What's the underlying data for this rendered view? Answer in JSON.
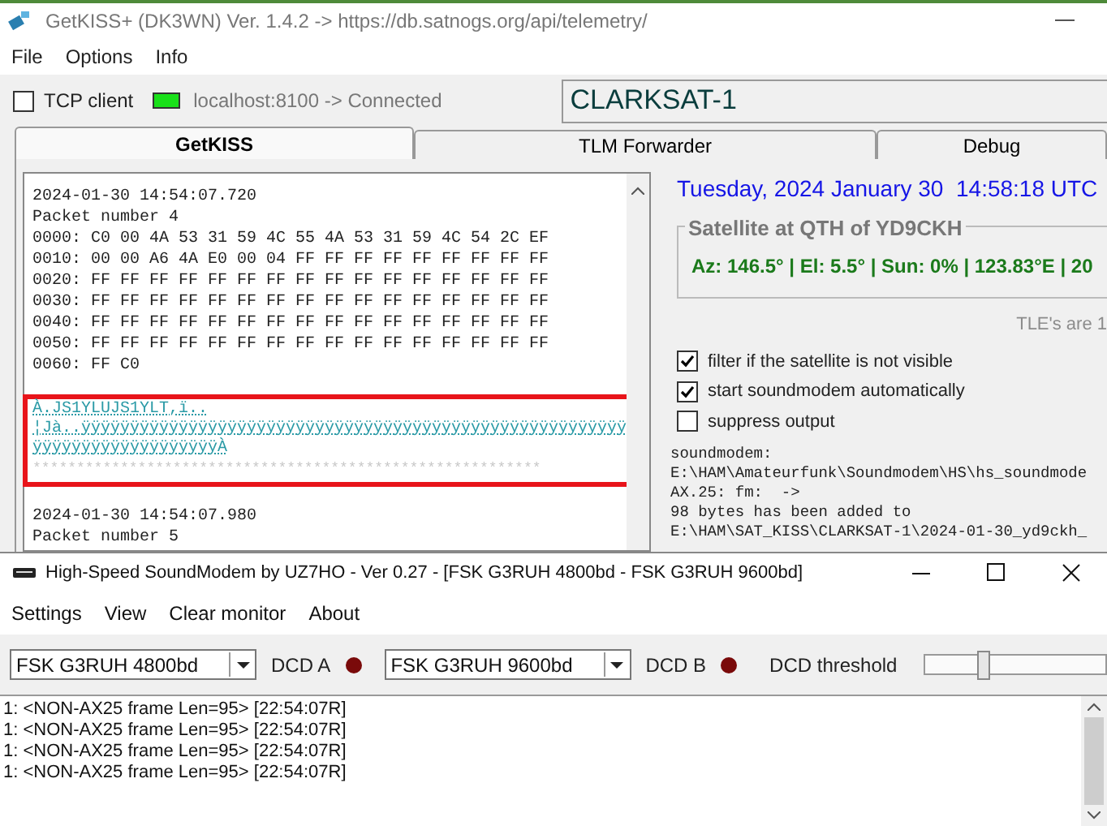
{
  "getkiss_window": {
    "title": "GetKISS+ (DK3WN) Ver. 1.4.2 -> https://db.satnogs.org/api/telemetry/",
    "menu": [
      "File",
      "Options",
      "Info"
    ],
    "tcp_client": {
      "label": "TCP client",
      "checked": false
    },
    "connection": {
      "status": "localhost:8100 -> Connected",
      "connected": true
    },
    "satellite_field": {
      "value": "CLARKSAT-1"
    },
    "tabs": [
      {
        "label": "GetKISS",
        "selected": true
      },
      {
        "label": "TLM Forwarder",
        "selected": false
      },
      {
        "label": "Debug",
        "selected": false
      }
    ],
    "monitor": {
      "lines": [
        "2024-01-30 14:54:07.720",
        "Packet number 4",
        "0000: C0 00 4A 53 31 59 4C 55 4A 53 31 59 4C 54 2C EF",
        "0010: 00 00 A6 4A E0 00 04 FF FF FF FF FF FF FF FF FF",
        "0020: FF FF FF FF FF FF FF FF FF FF FF FF FF FF FF FF",
        "0030: FF FF FF FF FF FF FF FF FF FF FF FF FF FF FF FF",
        "0040: FF FF FF FF FF FF FF FF FF FF FF FF FF FF FF FF",
        "0050: FF FF FF FF FF FF FF FF FF FF FF FF FF FF FF FF",
        "0060: FF C0"
      ],
      "decoded": [
        {
          "kind": "text",
          "text": "À.JS1YLUJS1YLT,ï.."
        },
        {
          "kind": "text",
          "text": "¦Jà..ÿÿÿÿÿÿÿÿÿÿÿÿÿÿÿÿÿÿÿÿÿÿÿÿÿÿÿÿÿÿÿÿÿÿÿÿÿÿÿÿÿÿÿÿÿÿÿÿÿÿÿÿÿÿÿÿ"
        },
        {
          "kind": "text",
          "text": "ÿÿÿÿÿÿÿÿÿÿÿÿÿÿÿÿÿÿÿÀ"
        },
        {
          "kind": "separator",
          "text": "**********************************************************"
        }
      ],
      "lines_after": [
        "2024-01-30 14:54:07.980",
        "Packet number 5"
      ]
    },
    "datetime": "Tuesday, 2024 January 30  14:58:18 UTC",
    "satellite_group": {
      "title": "Satellite at QTH of YD9CKH",
      "reading": "Az: 146.5° | El: 5.5° | Sun: 0% | 123.83°E | 20"
    },
    "tle_note": "TLE's are 1",
    "options": [
      {
        "label": "filter if the satellite is not visible",
        "checked": true
      },
      {
        "label": "start soundmodem automatically",
        "checked": true
      },
      {
        "label": "suppress output",
        "checked": false
      }
    ],
    "log": [
      "soundmodem:",
      "E:\\HAM\\Amateurfunk\\Soundmodem\\HS\\hs_soundmode",
      "AX.25: fm:  ->",
      "98 bytes has been added to",
      "E:\\HAM\\SAT_KISS\\CLARKSAT-1\\2024-01-30_yd9ckh_"
    ]
  },
  "soundmodem_window": {
    "title": "High-Speed SoundModem by UZ7HO - Ver 0.27 - [FSK G3RUH 4800bd - FSK G3RUH 9600bd]",
    "menu": [
      "Settings",
      "View",
      "Clear monitor",
      "About"
    ],
    "modems": [
      {
        "value": "FSK G3RUH 4800bd",
        "dcd_label": "DCD A"
      },
      {
        "value": "FSK G3RUH 9600bd",
        "dcd_label": "DCD B"
      }
    ],
    "dcd_threshold": {
      "label": "DCD threshold",
      "level": 0.3
    },
    "monitor": [
      "1: <NON-AX25 frame Len=95> [22:54:07R]",
      "1: <NON-AX25 frame Len=95> [22:54:07R]",
      "1: <NON-AX25 frame Len=95> [22:54:07R]",
      "1: <NON-AX25 frame Len=95> [22:54:07R]"
    ]
  }
}
